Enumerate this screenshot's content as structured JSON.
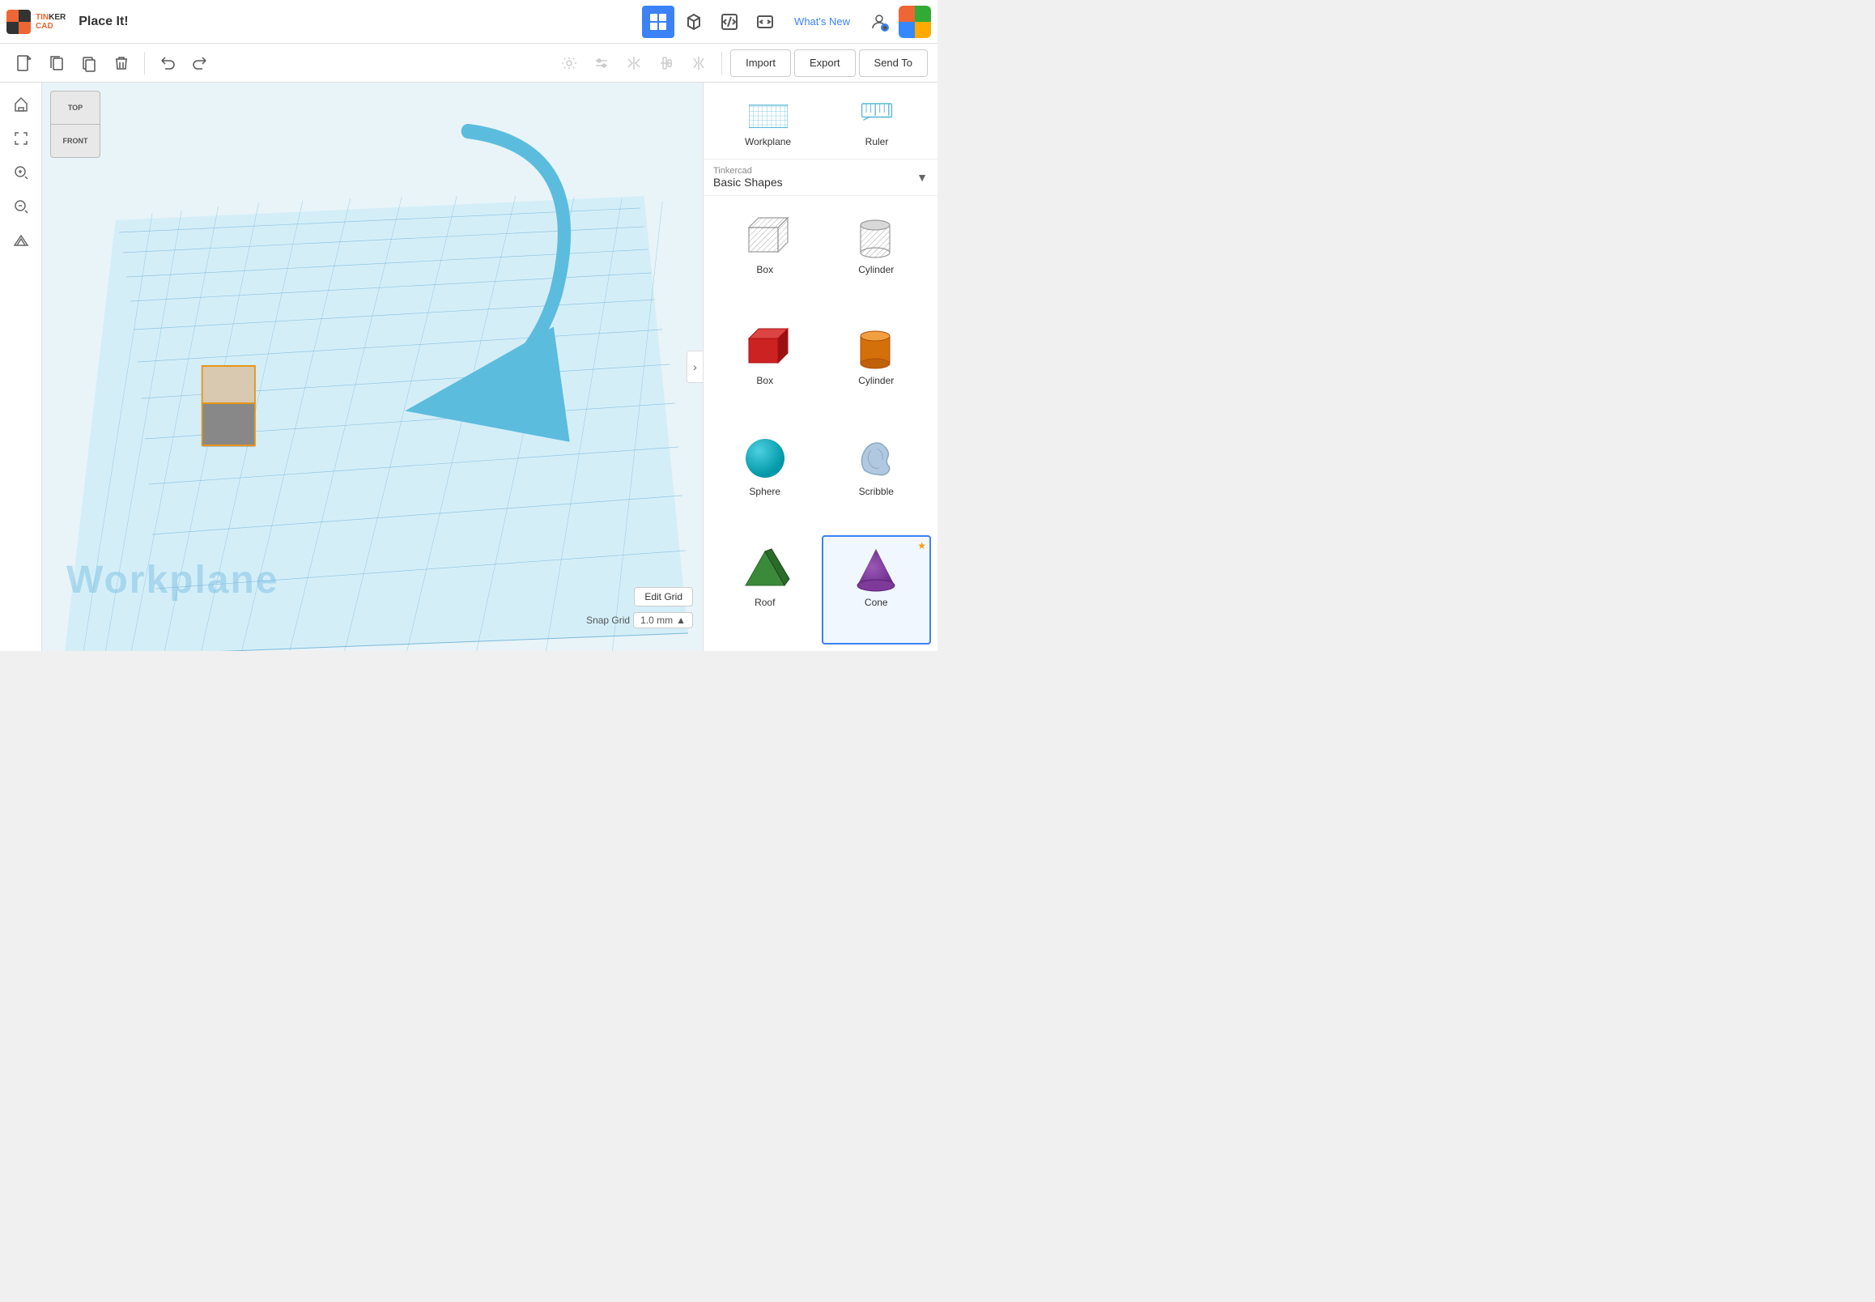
{
  "app": {
    "title": "Place It!",
    "logo_tin": "TIN",
    "logo_ker": "KER",
    "logo_cad": "CAD"
  },
  "topbar": {
    "project_title": "Place It!",
    "whats_new": "What's New",
    "nav_buttons": [
      {
        "id": "grid-view",
        "label": "Grid View",
        "active": true
      },
      {
        "id": "build-view",
        "label": "Build View",
        "active": false
      },
      {
        "id": "code-view",
        "label": "Code View",
        "active": false
      },
      {
        "id": "embed-view",
        "label": "Embed View",
        "active": false
      }
    ]
  },
  "toolbar2": {
    "new_label": "New",
    "copy_label": "Copy",
    "duplicate_label": "Duplicate",
    "delete_label": "Delete",
    "undo_label": "Undo",
    "redo_label": "Redo",
    "import_label": "Import",
    "export_label": "Export",
    "send_to_label": "Send To"
  },
  "left_sidebar": {
    "home_label": "Home",
    "fit_label": "Fit",
    "zoom_in_label": "Zoom In",
    "zoom_out_label": "Zoom Out",
    "perspective_label": "Perspective"
  },
  "viewport": {
    "workplane_label": "Workplane",
    "edit_grid_label": "Edit Grid",
    "snap_grid_label": "Snap Grid",
    "snap_value": "1.0 mm"
  },
  "view_cube": {
    "top_label": "TOP",
    "front_label": "FRONT"
  },
  "right_panel": {
    "workplane_label": "Workplane",
    "ruler_label": "Ruler",
    "category_meta": "Tinkercad",
    "category_name": "Basic Shapes",
    "shapes": [
      {
        "id": "box-grey",
        "label": "Box",
        "type": "box-grey",
        "selected": false,
        "starred": false
      },
      {
        "id": "cylinder-grey",
        "label": "Cylinder",
        "type": "cyl-grey",
        "selected": false,
        "starred": false
      },
      {
        "id": "box-red",
        "label": "Box",
        "type": "box-red",
        "selected": false,
        "starred": false
      },
      {
        "id": "cylinder-orange",
        "label": "Cylinder",
        "type": "cyl-orange",
        "selected": false,
        "starred": false
      },
      {
        "id": "sphere",
        "label": "Sphere",
        "type": "sphere",
        "selected": false,
        "starred": false
      },
      {
        "id": "scribble",
        "label": "Scribble",
        "type": "scribble",
        "selected": false,
        "starred": false
      },
      {
        "id": "roof",
        "label": "Roof",
        "type": "roof",
        "selected": false,
        "starred": false
      },
      {
        "id": "cone",
        "label": "Cone",
        "type": "cone",
        "selected": false,
        "starred": true
      }
    ]
  }
}
